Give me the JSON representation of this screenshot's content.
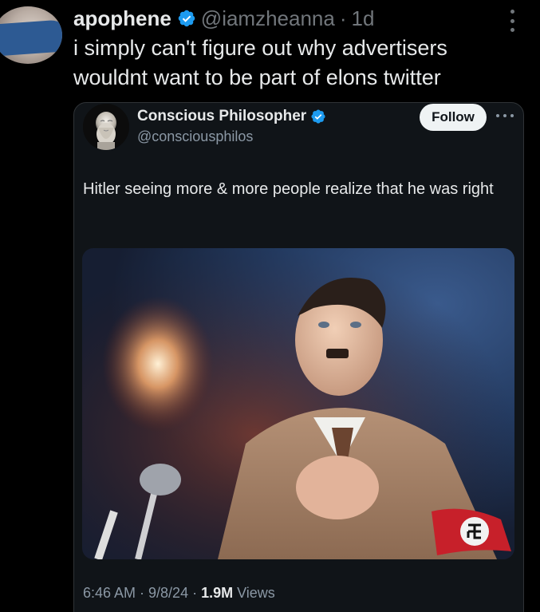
{
  "outer_tweet": {
    "display_name": "apophene",
    "handle": "@iamzheanna",
    "separator": "·",
    "time": "1d",
    "text": "i simply can't figure out why advertisers wouldnt want to be part of elons twitter"
  },
  "quoted_tweet": {
    "display_name": "Conscious Philosopher",
    "handle": "@consciousphilos",
    "follow_label": "Follow",
    "text": "Hitler seeing more & more people realize that he was right",
    "timestamp": "6:46 AM · 9/8/24 · ",
    "views_count": "1.9M",
    "views_label": " Views"
  },
  "colors": {
    "background": "#000000",
    "card_background": "#101418",
    "text_primary": "#e7e9ea",
    "text_secondary": "#71767b",
    "verified_badge": "#1d9bf0",
    "follow_button_bg": "#eff3f4",
    "avatar_redaction": "#2d5a93"
  },
  "icons": {
    "verified": "verified-badge-icon",
    "more_vertical": "more-vertical-icon",
    "more_horizontal": "more-horizontal-icon"
  }
}
